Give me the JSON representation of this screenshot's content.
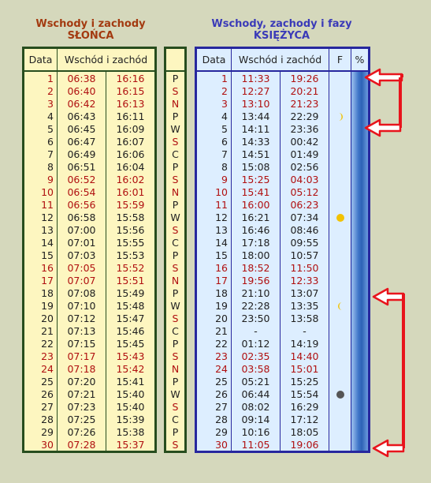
{
  "sun": {
    "title1": "Wschody i zachody",
    "title2": "SŁOŃCA",
    "headers": [
      "Data",
      "Wschód i zachód"
    ],
    "rows": [
      {
        "d": "1",
        "r": "06:38",
        "s": "16:16",
        "red": true
      },
      {
        "d": "2",
        "r": "06:40",
        "s": "16:15",
        "red": true
      },
      {
        "d": "3",
        "r": "06:42",
        "s": "16:13",
        "red": true
      },
      {
        "d": "4",
        "r": "06:43",
        "s": "16:11",
        "red": false
      },
      {
        "d": "5",
        "r": "06:45",
        "s": "16:09",
        "red": false
      },
      {
        "d": "6",
        "r": "06:47",
        "s": "16:07",
        "red": false
      },
      {
        "d": "7",
        "r": "06:49",
        "s": "16:06",
        "red": false
      },
      {
        "d": "8",
        "r": "06:51",
        "s": "16:04",
        "red": false
      },
      {
        "d": "9",
        "r": "06:52",
        "s": "16:02",
        "red": true
      },
      {
        "d": "10",
        "r": "06:54",
        "s": "16:01",
        "red": true
      },
      {
        "d": "11",
        "r": "06:56",
        "s": "15:59",
        "red": true
      },
      {
        "d": "12",
        "r": "06:58",
        "s": "15:58",
        "red": false
      },
      {
        "d": "13",
        "r": "07:00",
        "s": "15:56",
        "red": false
      },
      {
        "d": "14",
        "r": "07:01",
        "s": "15:55",
        "red": false
      },
      {
        "d": "15",
        "r": "07:03",
        "s": "15:53",
        "red": false
      },
      {
        "d": "16",
        "r": "07:05",
        "s": "15:52",
        "red": true
      },
      {
        "d": "17",
        "r": "07:07",
        "s": "15:51",
        "red": true
      },
      {
        "d": "18",
        "r": "07:08",
        "s": "15:49",
        "red": false
      },
      {
        "d": "19",
        "r": "07:10",
        "s": "15:48",
        "red": false
      },
      {
        "d": "20",
        "r": "07:12",
        "s": "15:47",
        "red": false
      },
      {
        "d": "21",
        "r": "07:13",
        "s": "15:46",
        "red": false
      },
      {
        "d": "22",
        "r": "07:15",
        "s": "15:45",
        "red": false
      },
      {
        "d": "23",
        "r": "07:17",
        "s": "15:43",
        "red": true
      },
      {
        "d": "24",
        "r": "07:18",
        "s": "15:42",
        "red": true
      },
      {
        "d": "25",
        "r": "07:20",
        "s": "15:41",
        "red": false
      },
      {
        "d": "26",
        "r": "07:21",
        "s": "15:40",
        "red": false
      },
      {
        "d": "27",
        "r": "07:23",
        "s": "15:40",
        "red": false
      },
      {
        "d": "28",
        "r": "07:25",
        "s": "15:39",
        "red": false
      },
      {
        "d": "29",
        "r": "07:26",
        "s": "15:38",
        "red": false
      },
      {
        "d": "30",
        "r": "07:28",
        "s": "15:37",
        "red": true
      }
    ]
  },
  "days": [
    "P",
    "S",
    "N",
    "P",
    "W",
    "S",
    "C",
    "P",
    "S",
    "N",
    "P",
    "W",
    "S",
    "C",
    "P",
    "S",
    "N",
    "P",
    "W",
    "S",
    "C",
    "P",
    "S",
    "N",
    "P",
    "W",
    "S",
    "C",
    "P",
    "S"
  ],
  "moon": {
    "title1": "Wschody, zachody i fazy",
    "title2": "KSIĘŻYCA",
    "headers": [
      "Data",
      "Wschód i zachód",
      "F",
      "%"
    ],
    "rows": [
      {
        "d": "1",
        "r": "11:33",
        "s": "19:26",
        "red": true,
        "f": ""
      },
      {
        "d": "2",
        "r": "12:27",
        "s": "20:21",
        "red": true,
        "f": ""
      },
      {
        "d": "3",
        "r": "13:10",
        "s": "21:23",
        "red": true,
        "f": ""
      },
      {
        "d": "4",
        "r": "13:44",
        "s": "22:29",
        "red": false,
        "f": "first-quarter"
      },
      {
        "d": "5",
        "r": "14:11",
        "s": "23:36",
        "red": false,
        "f": ""
      },
      {
        "d": "6",
        "r": "14:33",
        "s": "00:42",
        "red": false,
        "f": ""
      },
      {
        "d": "7",
        "r": "14:51",
        "s": "01:49",
        "red": false,
        "f": ""
      },
      {
        "d": "8",
        "r": "15:08",
        "s": "02:56",
        "red": false,
        "f": ""
      },
      {
        "d": "9",
        "r": "15:25",
        "s": "04:03",
        "red": true,
        "f": ""
      },
      {
        "d": "10",
        "r": "15:41",
        "s": "05:12",
        "red": true,
        "f": ""
      },
      {
        "d": "11",
        "r": "16:00",
        "s": "06:23",
        "red": true,
        "f": ""
      },
      {
        "d": "12",
        "r": "16:21",
        "s": "07:34",
        "red": false,
        "f": "full-moon"
      },
      {
        "d": "13",
        "r": "16:46",
        "s": "08:46",
        "red": false,
        "f": ""
      },
      {
        "d": "14",
        "r": "17:18",
        "s": "09:55",
        "red": false,
        "f": ""
      },
      {
        "d": "15",
        "r": "18:00",
        "s": "10:57",
        "red": false,
        "f": ""
      },
      {
        "d": "16",
        "r": "18:52",
        "s": "11:50",
        "red": true,
        "f": ""
      },
      {
        "d": "17",
        "r": "19:56",
        "s": "12:33",
        "red": true,
        "f": ""
      },
      {
        "d": "18",
        "r": "21:10",
        "s": "13:07",
        "red": false,
        "f": ""
      },
      {
        "d": "19",
        "r": "22:28",
        "s": "13:35",
        "red": false,
        "f": "last-quarter"
      },
      {
        "d": "20",
        "r": "23:50",
        "s": "13:58",
        "red": false,
        "f": ""
      },
      {
        "d": "21",
        "r": "-",
        "s": "-",
        "red": false,
        "f": ""
      },
      {
        "d": "22",
        "r": "01:12",
        "s": "14:19",
        "red": false,
        "f": ""
      },
      {
        "d": "23",
        "r": "02:35",
        "s": "14:40",
        "red": true,
        "f": ""
      },
      {
        "d": "24",
        "r": "03:58",
        "s": "15:01",
        "red": true,
        "f": ""
      },
      {
        "d": "25",
        "r": "05:21",
        "s": "15:25",
        "red": false,
        "f": ""
      },
      {
        "d": "26",
        "r": "06:44",
        "s": "15:54",
        "red": false,
        "f": "new-moon"
      },
      {
        "d": "27",
        "r": "08:02",
        "s": "16:29",
        "red": false,
        "f": ""
      },
      {
        "d": "28",
        "r": "09:14",
        "s": "17:12",
        "red": false,
        "f": ""
      },
      {
        "d": "29",
        "r": "10:16",
        "s": "18:05",
        "red": false,
        "f": ""
      },
      {
        "d": "30",
        "r": "11:05",
        "s": "19:06",
        "red": true,
        "f": ""
      }
    ]
  },
  "colors": {
    "red": "#b01010",
    "sun_title": "#a33a10",
    "moon_title": "#3a3ab8",
    "phase_yellow": "#f2c200",
    "phase_new": "#555555",
    "arrow": "#e8141c"
  }
}
